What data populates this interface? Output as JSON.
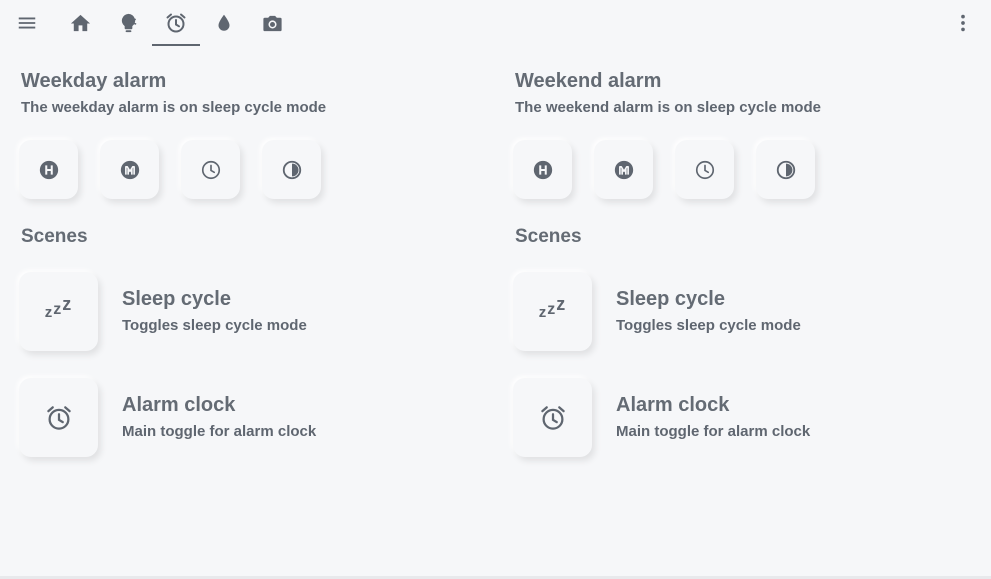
{
  "nav": {
    "menu_icon": "hamburger-menu-icon",
    "tabs": [
      {
        "icon": "home-icon",
        "active": false
      },
      {
        "icon": "lightbulb-icon",
        "active": false
      },
      {
        "icon": "alarm-clock-icon",
        "active": true
      },
      {
        "icon": "water-drop-icon",
        "active": false
      },
      {
        "icon": "camera-icon",
        "active": false
      }
    ],
    "overflow_icon": "more-vertical-icon"
  },
  "weekday": {
    "title": "Weekday alarm",
    "subtitle": "The weekday alarm is on sleep cycle mode",
    "buttons": [
      "alpha-h-circle-icon",
      "alpha-m-circle-icon",
      "clock-outline-icon",
      "circle-half-icon"
    ],
    "scenes_title": "Scenes",
    "scenes": [
      {
        "name": "Sleep cycle",
        "description": "Toggles sleep cycle mode",
        "icon": "sleep-zzz-icon",
        "icon_text": "zzz"
      },
      {
        "name": "Alarm clock",
        "description": "Main toggle for alarm clock",
        "icon": "alarm-clock-icon"
      }
    ]
  },
  "weekend": {
    "title": "Weekend alarm",
    "subtitle": "The weekend alarm is on sleep cycle mode",
    "buttons": [
      "alpha-h-circle-icon",
      "alpha-m-circle-icon",
      "clock-outline-icon",
      "circle-half-icon"
    ],
    "scenes_title": "Scenes",
    "scenes": [
      {
        "name": "Sleep cycle",
        "description": "Toggles sleep cycle mode",
        "icon": "sleep-zzz-icon",
        "icon_text": "zzz"
      },
      {
        "name": "Alarm clock",
        "description": "Main toggle for alarm clock",
        "icon": "alarm-clock-icon"
      }
    ]
  },
  "colors": {
    "background": "#f6f7f9",
    "text": "#5f6670",
    "icon": "#5f6670"
  }
}
